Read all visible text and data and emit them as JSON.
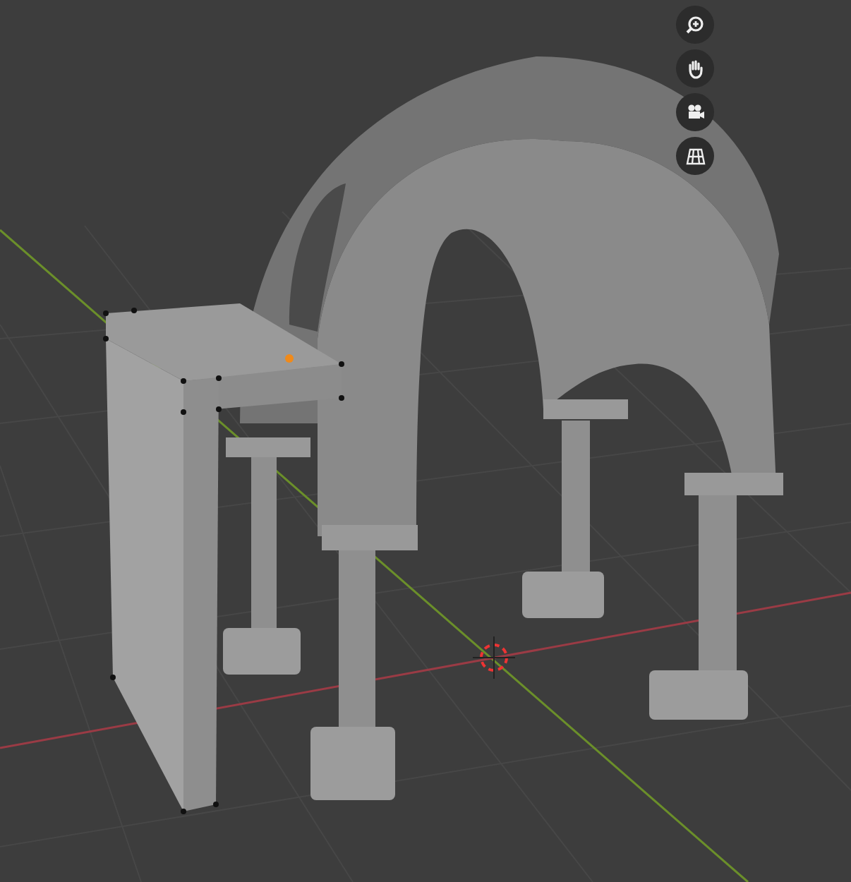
{
  "viewport": {
    "navigation_buttons": [
      {
        "kind": "zoom"
      },
      {
        "kind": "pan"
      },
      {
        "kind": "camera"
      },
      {
        "kind": "perspective"
      }
    ]
  }
}
